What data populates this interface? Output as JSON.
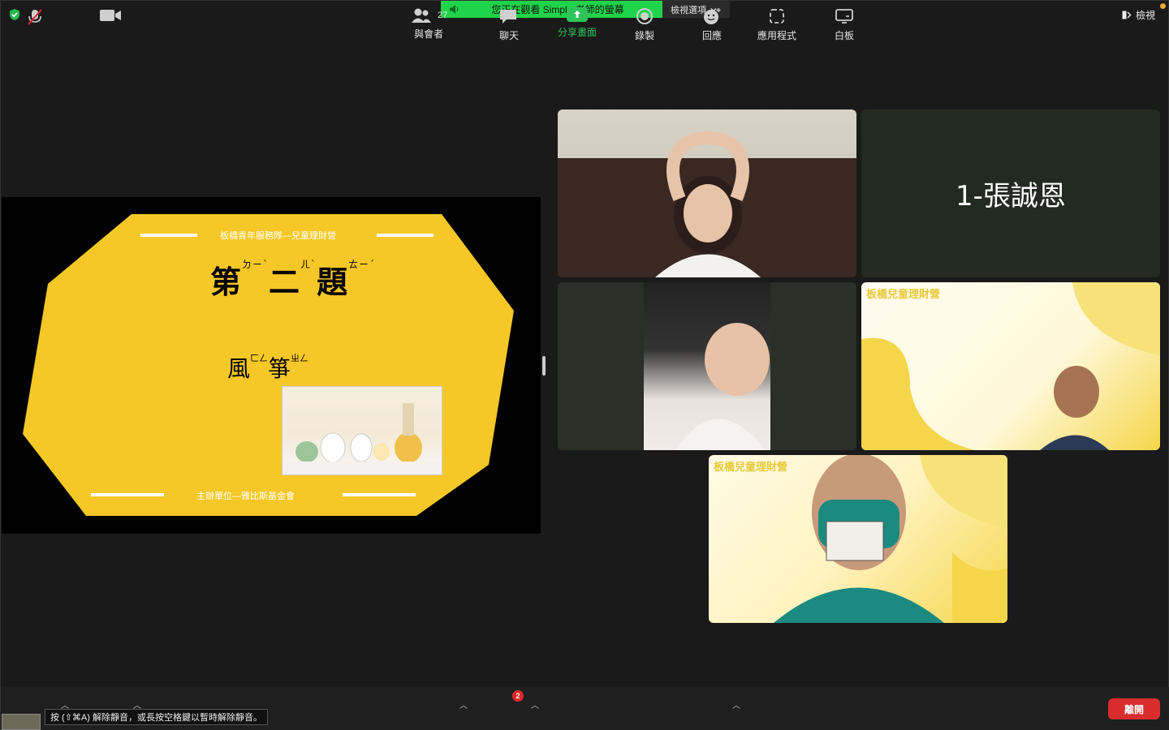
{
  "top_bar": {
    "share_status": "您正在觀看 Simple 老師的螢幕",
    "view_options_label": "檢視選項",
    "view_label": "檢視"
  },
  "slide": {
    "org_top": "板橋青年服務隊—兒童理財營",
    "title_chars": [
      "第",
      "二",
      "題"
    ],
    "title_bopomofo": [
      "ㄉㄧˋ",
      "ㄦˋ",
      "ㄊㄧˊ"
    ],
    "word_chars": [
      "風",
      "箏"
    ],
    "word_bopomofo": [
      "ㄈㄥ",
      "ㄓㄥ"
    ],
    "org_bottom": "主辦單位—雅比斯基金會",
    "colors": {
      "slide_yellow": "#f5c827",
      "slide_bg": "#000000"
    }
  },
  "participants": [
    {
      "id": "p1",
      "type": "video"
    },
    {
      "id": "p2",
      "type": "name",
      "display_name": "1-張誠恩"
    },
    {
      "id": "p3",
      "type": "video"
    },
    {
      "id": "p4",
      "type": "video",
      "background_text": "板橋兒童理財營"
    },
    {
      "id": "p5",
      "type": "video",
      "background_text": "板橋兒童理財營"
    }
  ],
  "toolbar": {
    "unmute_tooltip": "按 (⇧⌘A) 解除靜音，或長按空格鍵以暫時解除靜音。",
    "participants_label": "與會者",
    "participants_count": "27",
    "chat_label": "聊天",
    "chat_badge": "2",
    "share_label": "分享畫面",
    "record_label": "錄製",
    "reactions_label": "回應",
    "apps_label": "應用程式",
    "whiteboard_label": "白板",
    "leave_label": "離開",
    "colors": {
      "share_green": "#2ec45a",
      "leave_red": "#d92d2d"
    }
  }
}
